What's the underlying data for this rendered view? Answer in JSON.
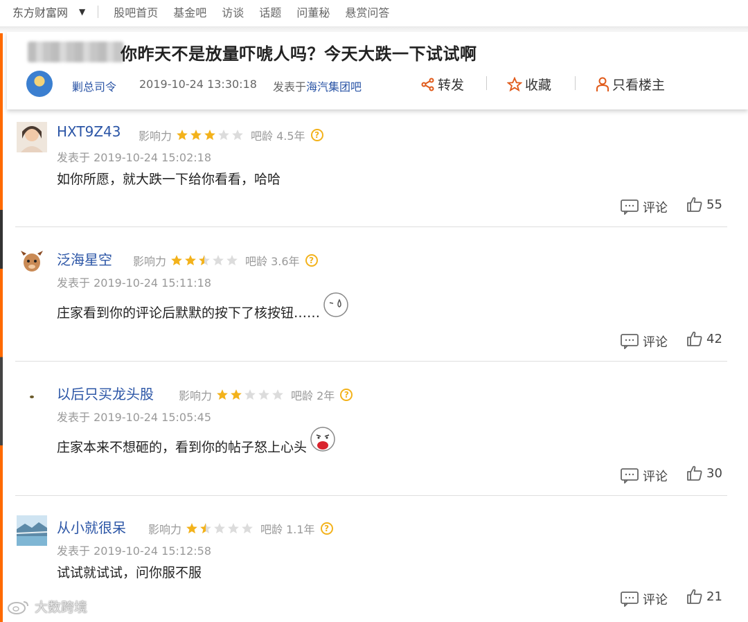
{
  "nav": {
    "site": "东方财富网",
    "items": [
      "股吧首页",
      "基金吧",
      "访谈",
      "话题",
      "问董秘",
      "悬赏问答"
    ]
  },
  "post": {
    "title": "你昨天不是放量吓唬人吗？今天大跌一下试试啊",
    "author": "剿总司令",
    "time": "2019-10-24 13:30:18",
    "posted_in_prefix": "发表于",
    "bar_name": "海汽集团吧",
    "actions": {
      "share": "转发",
      "favorite": "收藏",
      "only_op": "只看楼主"
    }
  },
  "labels": {
    "influence": "影响力",
    "posted_prefix": "发表于",
    "comment": "评论"
  },
  "comments": [
    {
      "user": "HXT9Z43",
      "stars": 3,
      "age": "吧龄 4.5年",
      "time": "2019-10-24 15:02:18",
      "text": "如你所愿，就大跌一下给你看看，哈哈",
      "likes": "55"
    },
    {
      "user": "泛海星空",
      "stars": 2.5,
      "age": "吧龄 3.6年",
      "time": "2019-10-24 15:11:18",
      "text": "庄家看到你的评论后默默的按下了核按钮……",
      "likes": "42"
    },
    {
      "user": "以后只买龙头股",
      "stars": 2,
      "age": "吧龄 2年",
      "time": "2019-10-24 15:05:45",
      "text": "庄家本来不想砸的，看到你的帖子怒上心头",
      "likes": "30"
    },
    {
      "user": "从小就很呆",
      "stars": 1.5,
      "age": "吧龄 1.1年",
      "time": "2019-10-24 15:12:58",
      "text": "试试就试试，问你服不服",
      "likes": "21"
    }
  ],
  "watermark": "大数跨境",
  "colors": {
    "link": "#2b55a6",
    "star": "#f3b21b",
    "accent": "#ff6a00"
  }
}
